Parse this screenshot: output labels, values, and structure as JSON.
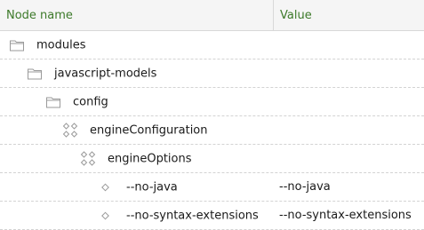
{
  "header": {
    "name_label": "Node name",
    "value_label": "Value",
    "header_text_color": "#3d7a2a"
  },
  "nodes": [
    {
      "name": "modules",
      "value": "",
      "icon": "folder-icon",
      "level": 0
    },
    {
      "name": "javascript-models",
      "value": "",
      "icon": "folder-icon",
      "level": 1
    },
    {
      "name": "config",
      "value": "",
      "icon": "folder-icon",
      "level": 2
    },
    {
      "name": "engineConfiguration",
      "value": "",
      "icon": "multi-value-node-icon",
      "level": 3
    },
    {
      "name": "engineOptions",
      "value": "",
      "icon": "multi-value-node-icon",
      "level": 4
    },
    {
      "name": "--no-java",
      "value": "--no-java",
      "icon": "property-diamond-icon",
      "level": 5
    },
    {
      "name": "--no-syntax-extensions",
      "value": "--no-syntax-extensions",
      "icon": "property-diamond-icon",
      "level": 5
    }
  ]
}
